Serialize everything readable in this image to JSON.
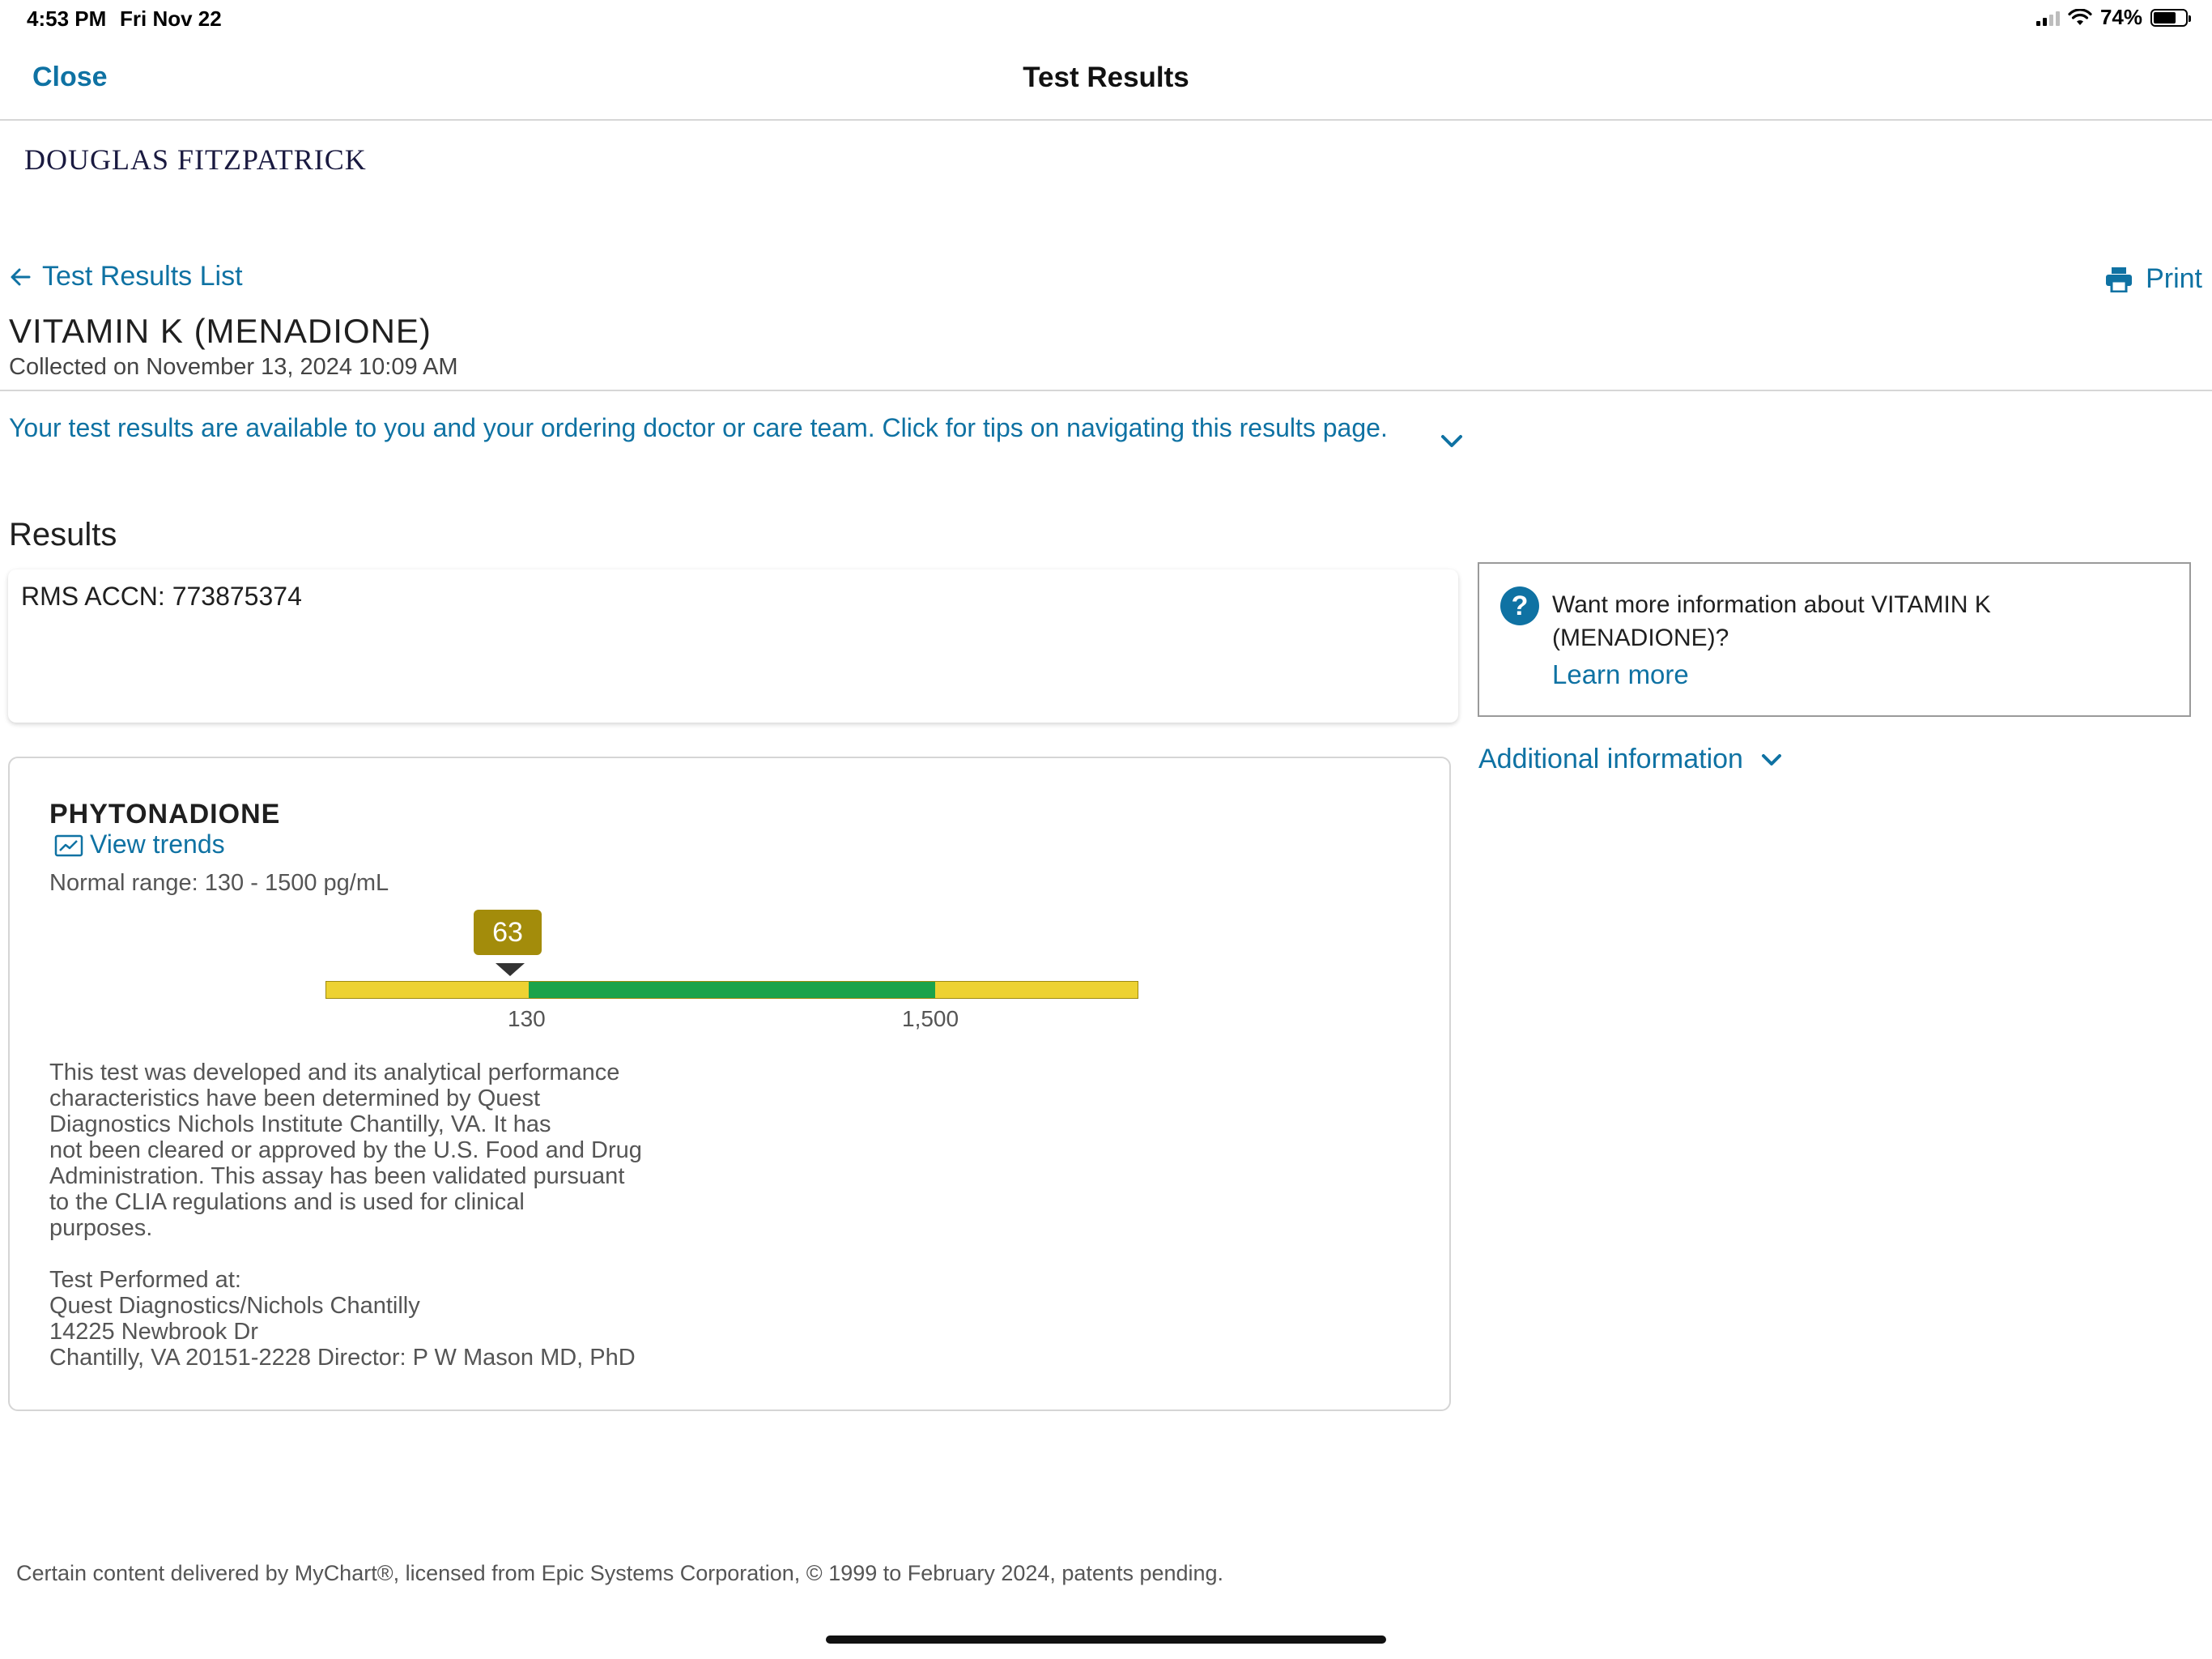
{
  "status_bar": {
    "time": "4:53 PM",
    "date": "Fri Nov 22",
    "battery": "74%"
  },
  "nav": {
    "close_label": "Close",
    "title": "Test Results"
  },
  "patient": {
    "name": "DOUGLAS FITZPATRICK"
  },
  "actions": {
    "back_label": "Test Results List",
    "print_label": "Print"
  },
  "test": {
    "title": "VITAMIN K (MENADIONE)",
    "collected": "Collected on November 13, 2024 10:09 AM",
    "tips": "Your test results are available to you and your ordering doctor or care team. Click for tips on navigating this results page."
  },
  "results": {
    "heading": "Results",
    "accession": "RMS ACCN: 773875374",
    "component": {
      "name": "PHYTONADIONE",
      "trends_label": "View trends",
      "normal_range": "Normal range: 130 - 1500 pg/mL",
      "value": "63",
      "range_low": "130",
      "range_high": "1,500",
      "disclaimer": "This test was developed and its analytical performance\ncharacteristics have been determined by Quest\nDiagnostics Nichols Institute Chantilly, VA. It has\nnot been cleared or approved by the U.S. Food and Drug\nAdministration. This assay has been validated pursuant\nto the CLIA regulations and is used for clinical\npurposes.",
      "performed_at": "Test Performed at:\nQuest Diagnostics/Nichols Chantilly\n14225 Newbrook Dr\nChantilly, VA 20151-2228 Director: P W Mason MD, PhD"
    }
  },
  "sidebar": {
    "info_question": "Want more information about VITAMIN K (MENADIONE)?",
    "learn_more": "Learn more",
    "additional_info": "Additional information"
  },
  "footer": {
    "text": "Certain content delivered by MyChart®, licensed from Epic Systems Corporation, © 1999 to February 2024, patents pending."
  },
  "colors": {
    "accent": "#0f72a3",
    "value_badge": "#a38c0b",
    "range_normal": "#1aa34a",
    "range_abnormal": "#edd232"
  },
  "icons": {
    "back": "arrow-left-icon",
    "print": "printer-icon",
    "tips": "chevron-down-icon",
    "trends": "trend-chart-icon",
    "info": "question-circle-icon",
    "additional": "chevron-down-icon"
  }
}
